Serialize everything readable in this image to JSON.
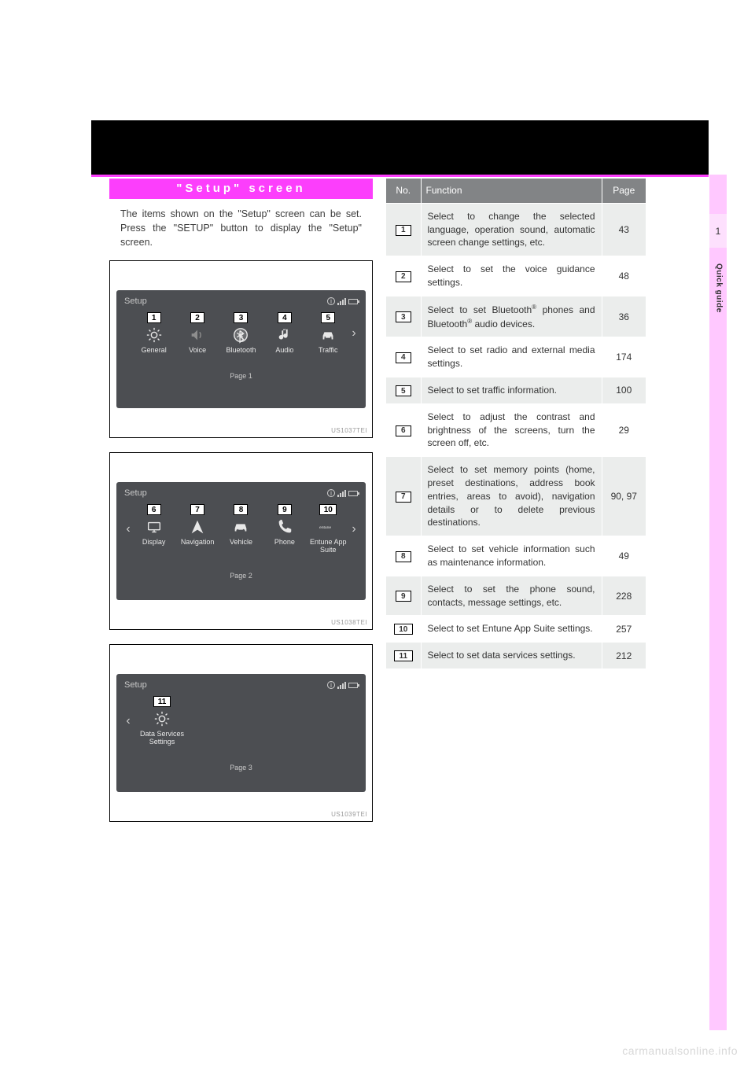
{
  "section": {
    "title": "\"Setup\" screen"
  },
  "intro": "The items shown on the \"Setup\" screen can be set. Press the \"SETUP\" button to display the \"Setup\" screen.",
  "chapter": {
    "number": "1",
    "label": "Quick guide"
  },
  "watermark": "carmanualsonline.info",
  "screens": [
    {
      "img_id": "US1037TEI",
      "title": "Setup",
      "page_label": "Page 1",
      "arrows": {
        "left": "",
        "right": "›"
      },
      "items": [
        {
          "idx": "1",
          "icon": "gear-sun-icon",
          "label": "General"
        },
        {
          "idx": "2",
          "icon": "voice-icon",
          "label": "Voice"
        },
        {
          "idx": "3",
          "icon": "bluetooth-icon",
          "label": "Bluetooth"
        },
        {
          "idx": "4",
          "icon": "note-icon",
          "label": "Audio"
        },
        {
          "idx": "5",
          "icon": "car-icon",
          "label": "Traffic"
        }
      ]
    },
    {
      "img_id": "US1038TEI",
      "title": "Setup",
      "page_label": "Page 2",
      "arrows": {
        "left": "‹",
        "right": "›"
      },
      "items": [
        {
          "idx": "6",
          "icon": "display-icon",
          "label": "Display"
        },
        {
          "idx": "7",
          "icon": "nav-icon",
          "label": "Navigation"
        },
        {
          "idx": "8",
          "icon": "vehicle-icon",
          "label": "Vehicle"
        },
        {
          "idx": "9",
          "icon": "phone-icon",
          "label": "Phone"
        },
        {
          "idx": "10",
          "icon": "entune-icon",
          "label": "Entune App Suite"
        }
      ]
    },
    {
      "img_id": "US1039TEI",
      "title": "Setup",
      "page_label": "Page 3",
      "arrows": {
        "left": "‹",
        "right": ""
      },
      "items": [
        {
          "idx": "11",
          "icon": "gear-sun-icon",
          "label": "Data Services Settings"
        }
      ]
    }
  ],
  "table": {
    "headers": {
      "no": "No.",
      "fn": "Function",
      "page": "Page"
    },
    "rows": [
      {
        "idx": "1",
        "fn": "Select to change the selected language, operation sound, automatic screen change settings, etc.",
        "page": "43"
      },
      {
        "idx": "2",
        "fn": "Select to set the voice guidance settings.",
        "page": "48"
      },
      {
        "idx": "3",
        "fn_html": "Select to set Bluetooth<span class=\"reg\">®</span> phones and Bluetooth<span class=\"reg\">®</span> audio devices.",
        "page": "36"
      },
      {
        "idx": "4",
        "fn": "Select to set radio and external media settings.",
        "page": "174"
      },
      {
        "idx": "5",
        "fn": "Select to set traffic information.",
        "page": "100"
      },
      {
        "idx": "6",
        "fn": "Select to adjust the contrast and brightness of the screens, turn the screen off, etc.",
        "page": "29"
      },
      {
        "idx": "7",
        "fn": "Select to set memory points (home, preset destinations, address book entries, areas to avoid), navigation details or to delete previous destinations.",
        "page": "90, 97"
      },
      {
        "idx": "8",
        "fn": "Select to set vehicle information such as maintenance information.",
        "page": "49"
      },
      {
        "idx": "9",
        "fn": "Select to set the phone sound, contacts, message settings, etc.",
        "page": "228"
      },
      {
        "idx": "10",
        "fn": "Select to set Entune App Suite settings.",
        "page": "257"
      },
      {
        "idx": "11",
        "fn": "Select to set data services settings.",
        "page": "212"
      }
    ]
  }
}
